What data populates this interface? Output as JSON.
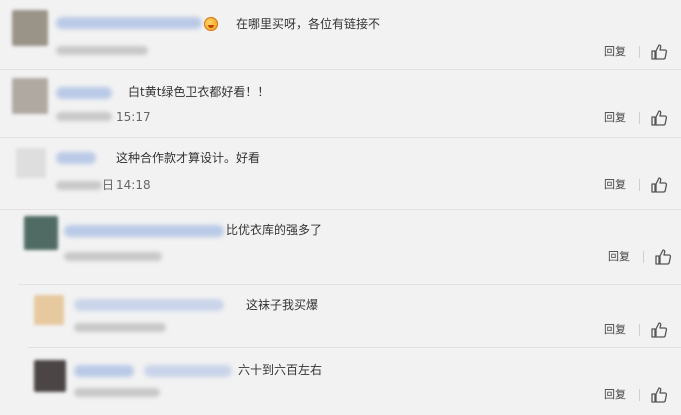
{
  "comments": [
    {
      "text": "在哪里买呀，各位有链接不",
      "time": "",
      "reply_label": "回复",
      "avatar_color": "#9a9488"
    },
    {
      "text": "白t黄t绿色卫衣都好看！！",
      "time": "15:17",
      "reply_label": "回复",
      "avatar_color": "#b0a9a2"
    },
    {
      "text": "这种合作款才算设计。好看",
      "time": "14:18",
      "time_prefix": "日",
      "reply_label": "回复",
      "avatar_color": "#dedede"
    },
    {
      "text": "比优衣库的强多了",
      "time": "",
      "reply_label": "回复",
      "avatar_color": "#4f6b63"
    },
    {
      "text": "这袜子我买爆",
      "time": "",
      "reply_label": "回复",
      "avatar_color": "#e7c9a0"
    },
    {
      "text": "六十到六百左右",
      "time": "",
      "reply_label": "回复",
      "avatar_color": "#4b4645"
    }
  ]
}
